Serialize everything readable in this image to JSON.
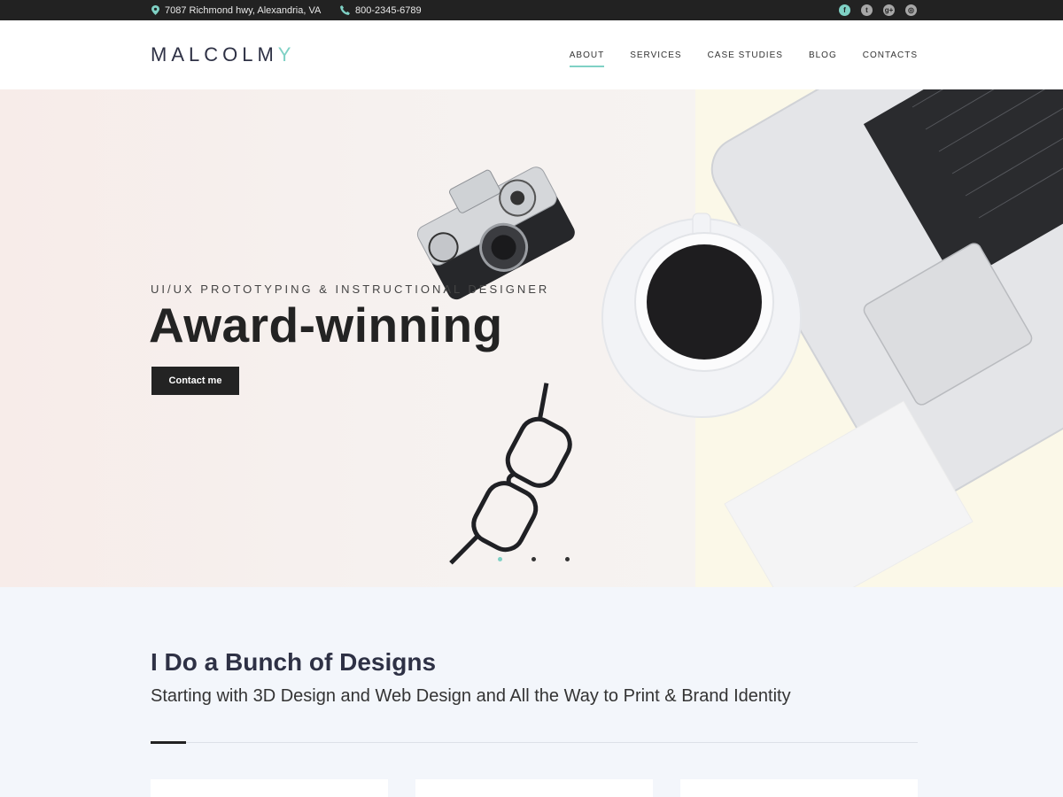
{
  "topbar": {
    "address": "7087 Richmond hwy, Alexandria, VA",
    "phone": "800-2345-6789",
    "social_icons": [
      "facebook-icon",
      "twitter-icon",
      "google-plus-icon",
      "instagram-icon"
    ]
  },
  "logo": {
    "main": "MALCOLM",
    "accent": "Y"
  },
  "nav": {
    "items": [
      {
        "label": "ABOUT",
        "active": true
      },
      {
        "label": "SERVICES"
      },
      {
        "label": "CASE STUDIES"
      },
      {
        "label": "BLOG"
      },
      {
        "label": "CONTACTS"
      }
    ]
  },
  "hero": {
    "subtitle": "UI/UX PROTOTYPING & INSTRUCTIONAL DESIGNER",
    "title": "Award-winning",
    "button": "Contact me",
    "slides": 3,
    "active_slide": 1
  },
  "section": {
    "title": "I Do a Bunch of Designs",
    "subtitle": "Starting with 3D Design and Web Design and All the Way to Print & Brand Identity"
  },
  "colors": {
    "accent": "#7fd1c5",
    "dark": "#222222",
    "heading": "#2e3145"
  }
}
